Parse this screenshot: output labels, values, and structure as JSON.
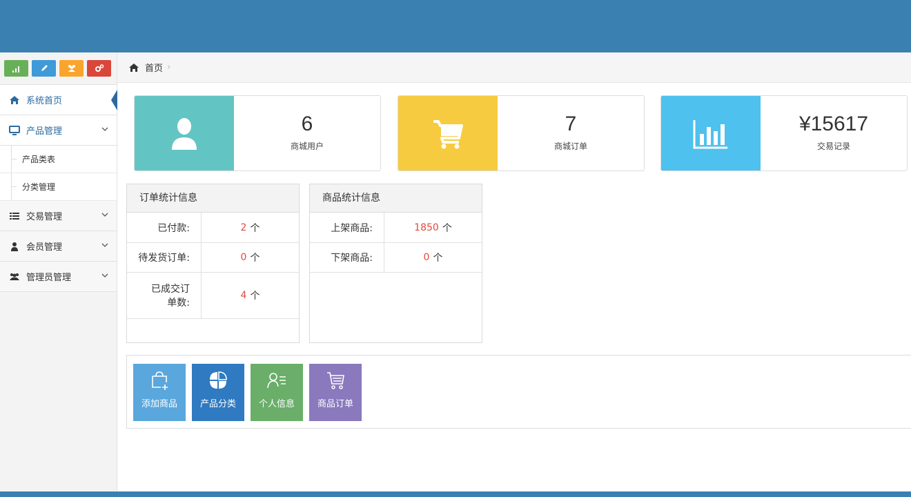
{
  "colors": {
    "header": "#3a80b0",
    "green": "#68b058",
    "blue": "#3f9ad8",
    "orange": "#f9a52d",
    "red": "#d9473b",
    "teal": "#62c5c4",
    "yellow": "#f7cb3f",
    "sky": "#4ec1ee",
    "accent_red": "#e8463c"
  },
  "sidebar": {
    "shortcuts": [
      {
        "icon": "signal-icon",
        "color": "#68b058"
      },
      {
        "icon": "pencil-icon",
        "color": "#3f9ad8"
      },
      {
        "icon": "users-icon",
        "color": "#f9a52d"
      },
      {
        "icon": "cogs-icon",
        "color": "#d9473b"
      }
    ],
    "items": [
      {
        "label": "系统首页",
        "icon": "home-icon"
      },
      {
        "label": "产品管理",
        "icon": "monitor-icon"
      },
      {
        "label": "交易管理",
        "icon": "list-icon"
      },
      {
        "label": "会员管理",
        "icon": "user-icon"
      },
      {
        "label": "管理员管理",
        "icon": "users-icon"
      }
    ],
    "subitems": [
      "产品类表",
      "分类管理"
    ]
  },
  "breadcrumb": {
    "home": "首页",
    "sep": "›"
  },
  "cards": [
    {
      "value": "6",
      "label": "商城用户",
      "icon": "user-icon",
      "color": "#62c5c4"
    },
    {
      "value": "7",
      "label": "商城订单",
      "icon": "cart-icon",
      "color": "#f7cb3f"
    },
    {
      "value": "¥15617",
      "label": "交易记录",
      "icon": "bar-chart-icon",
      "color": "#4ec1ee"
    }
  ],
  "order_stats": {
    "title": "订单统计信息",
    "rows": [
      {
        "label": "已付款:",
        "value": "2",
        "unit": "个"
      },
      {
        "label": "待发货订单:",
        "value": "0",
        "unit": "个"
      },
      {
        "label": "已成交订单数:",
        "value": "4",
        "unit": "个"
      }
    ]
  },
  "product_stats": {
    "title": "商品统计信息",
    "rows": [
      {
        "label": "上架商品:",
        "value": "1850",
        "unit": "个"
      },
      {
        "label": "下架商品:",
        "value": "0",
        "unit": "个"
      }
    ]
  },
  "quick_buttons": [
    {
      "label": "添加商品",
      "icon": "bag-plus-icon",
      "color": "#5aa7dd"
    },
    {
      "label": "产品分类",
      "icon": "category-icon",
      "color": "#2f7ac0"
    },
    {
      "label": "个人信息",
      "icon": "profile-icon",
      "color": "#6aae6a"
    },
    {
      "label": "商品订单",
      "icon": "cart-icon",
      "color": "#8a79bd"
    }
  ]
}
